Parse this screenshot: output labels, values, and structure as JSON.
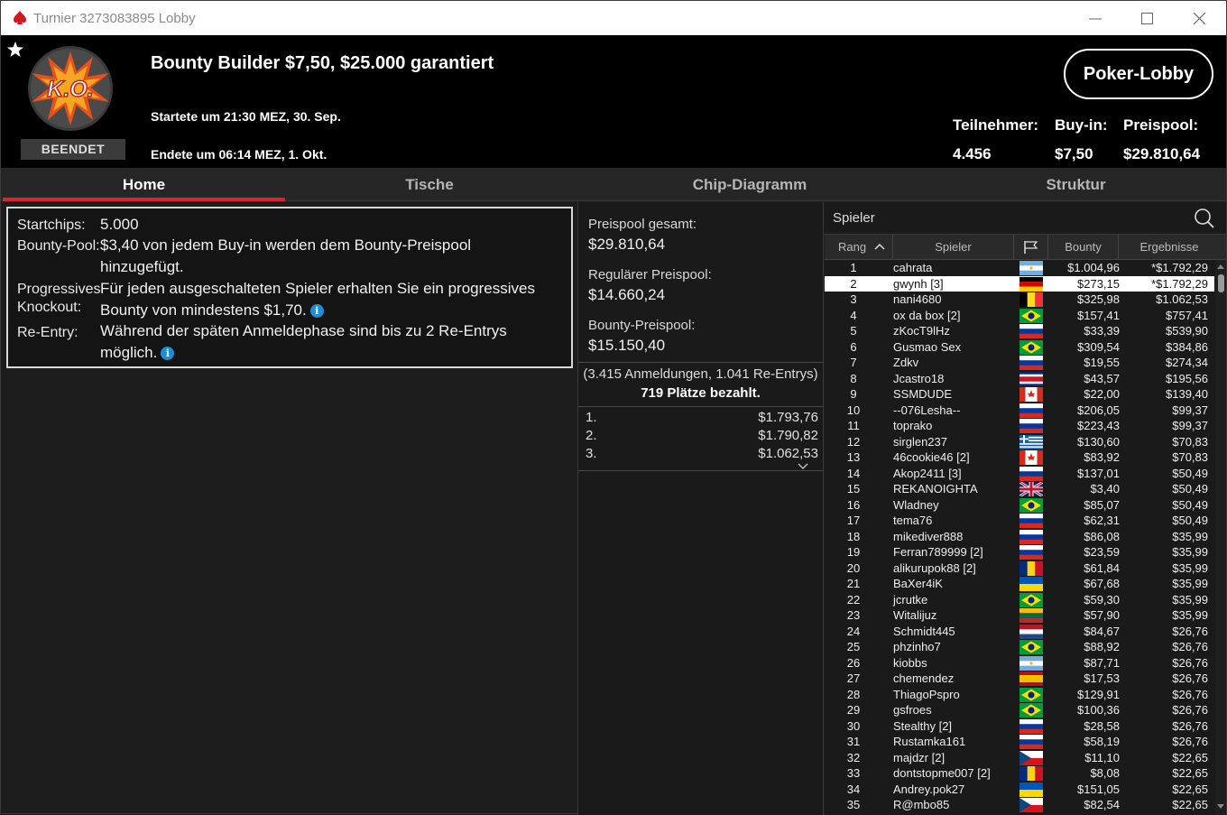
{
  "window": {
    "title": "Turnier 3273083895 Lobby"
  },
  "header": {
    "tournament_title": "Bounty Builder $7,50, $25.000 garantiert",
    "started": "Startete um 21:30 MEZ, 30. Sep.",
    "ended": "Endete um 06:14 MEZ, 1. Okt.",
    "status_badge": "BEENDET",
    "ko_logo_text": "K.O.",
    "lobby_button": "Poker-Lobby",
    "stats": [
      {
        "label": "Teilnehmer:",
        "value": "4.456"
      },
      {
        "label": "Buy-in:",
        "value": "$7,50"
      },
      {
        "label": "Preispool:",
        "value": "$29.810,64"
      }
    ]
  },
  "tabs": [
    {
      "label": "Home",
      "active": true
    },
    {
      "label": "Tische",
      "active": false
    },
    {
      "label": "Chip-Diagramm",
      "active": false
    },
    {
      "label": "Struktur",
      "active": false
    }
  ],
  "info": {
    "startchips_label": "Startchips:",
    "startchips_value": "5.000",
    "bountypool_label": "Bounty-Pool:",
    "bountypool_value": "$3,40 von jedem Buy-in werden dem Bounty-Preispool hinzugefügt.",
    "pko_label_1": "Progressives",
    "pko_label_2": "Knockout:",
    "pko_value": "Für jeden ausgeschalteten Spieler erhalten Sie ein progressives Bounty von mindestens $1,70.",
    "reentry_label": "Re-Entry:",
    "reentry_value": "Während der späten Anmeldephase sind bis zu 2 Re-Entrys möglich."
  },
  "prizepool": {
    "total_label": "Preispool gesamt:",
    "total_value": "$29.810,64",
    "regular_label": "Regulärer Preispool:",
    "regular_value": "$14.660,24",
    "bounty_label": "Bounty-Preispool:",
    "bounty_value": "$15.150,40",
    "registrations": "(3.415 Anmeldungen, 1.041 Re-Entrys)",
    "paid_places": "719 Plätze bezahlt.",
    "payouts": [
      {
        "place": "1.",
        "amount": "$1.793,76"
      },
      {
        "place": "2.",
        "amount": "$1.790,82"
      },
      {
        "place": "3.",
        "amount": "$1.062,53"
      }
    ]
  },
  "players_panel": {
    "search_label": "Spieler",
    "columns": {
      "rank": "Rang",
      "player": "Spieler",
      "bounty": "Bounty",
      "results": "Ergebnisse"
    },
    "highlighted_rank": 2,
    "rows": [
      {
        "rank": "1",
        "name": "cahrata",
        "flag": "ar",
        "bounty": "$1.004,96",
        "result": "*$1.792,29"
      },
      {
        "rank": "2",
        "name": "gwynh [3]",
        "flag": "de",
        "bounty": "$273,15",
        "result": "*$1.792,29"
      },
      {
        "rank": "3",
        "name": "nani4680",
        "flag": "be",
        "bounty": "$325,98",
        "result": "$1.062,53"
      },
      {
        "rank": "4",
        "name": "ox da box [2]",
        "flag": "br",
        "bounty": "$157,41",
        "result": "$757,41"
      },
      {
        "rank": "5",
        "name": "zKocT9lHz",
        "flag": "ru",
        "bounty": "$33,39",
        "result": "$539,90"
      },
      {
        "rank": "6",
        "name": "Gusmao Sex",
        "flag": "br",
        "bounty": "$309,54",
        "result": "$384,86"
      },
      {
        "rank": "7",
        "name": "Zdkv",
        "flag": "ru",
        "bounty": "$19,55",
        "result": "$274,34"
      },
      {
        "rank": "8",
        "name": "Jcastro18",
        "flag": "cr",
        "bounty": "$43,57",
        "result": "$195,56"
      },
      {
        "rank": "9",
        "name": "SSMDUDE",
        "flag": "ca",
        "bounty": "$22,00",
        "result": "$139,40"
      },
      {
        "rank": "10",
        "name": "--076Lesha--",
        "flag": "ru",
        "bounty": "$206,05",
        "result": "$99,37"
      },
      {
        "rank": "11",
        "name": "toprako",
        "flag": "ru",
        "bounty": "$223,43",
        "result": "$99,37"
      },
      {
        "rank": "12",
        "name": "sirglen237",
        "flag": "gr",
        "bounty": "$130,60",
        "result": "$70,83"
      },
      {
        "rank": "13",
        "name": "46cookie46 [2]",
        "flag": "ca",
        "bounty": "$83,92",
        "result": "$70,83"
      },
      {
        "rank": "14",
        "name": "Akop2411 [3]",
        "flag": "ru",
        "bounty": "$137,01",
        "result": "$50,49"
      },
      {
        "rank": "15",
        "name": "REKANOIGHTA",
        "flag": "gb",
        "bounty": "$3,40",
        "result": "$50,49"
      },
      {
        "rank": "16",
        "name": "Wladney",
        "flag": "br",
        "bounty": "$85,07",
        "result": "$50,49"
      },
      {
        "rank": "17",
        "name": "tema76",
        "flag": "ru",
        "bounty": "$62,31",
        "result": "$50,49"
      },
      {
        "rank": "18",
        "name": "mikediver888",
        "flag": "ru",
        "bounty": "$86,08",
        "result": "$35,99"
      },
      {
        "rank": "19",
        "name": "Ferran789999 [2]",
        "flag": "ru",
        "bounty": "$23,59",
        "result": "$35,99"
      },
      {
        "rank": "20",
        "name": "alikurupok88 [2]",
        "flag": "ro",
        "bounty": "$61,84",
        "result": "$35,99"
      },
      {
        "rank": "21",
        "name": "BaXer4iK",
        "flag": "ua",
        "bounty": "$67,68",
        "result": "$35,99"
      },
      {
        "rank": "22",
        "name": "jcrutke",
        "flag": "br",
        "bounty": "$59,30",
        "result": "$35,99"
      },
      {
        "rank": "23",
        "name": "Witalijuz",
        "flag": "lt",
        "bounty": "$57,90",
        "result": "$35,99"
      },
      {
        "rank": "24",
        "name": "Schmidt445",
        "flag": "nl",
        "bounty": "$84,67",
        "result": "$26,76"
      },
      {
        "rank": "25",
        "name": "phzinho7",
        "flag": "br",
        "bounty": "$88,92",
        "result": "$26,76"
      },
      {
        "rank": "26",
        "name": "kiobbs",
        "flag": "ar",
        "bounty": "$87,71",
        "result": "$26,76"
      },
      {
        "rank": "27",
        "name": "chemendez",
        "flag": "es",
        "bounty": "$17,53",
        "result": "$26,76"
      },
      {
        "rank": "28",
        "name": "ThiagoPspro",
        "flag": "br",
        "bounty": "$129,91",
        "result": "$26,76"
      },
      {
        "rank": "29",
        "name": "gsfroes",
        "flag": "br",
        "bounty": "$100,36",
        "result": "$26,76"
      },
      {
        "rank": "30",
        "name": "Stealthy [2]",
        "flag": "ru",
        "bounty": "$28,58",
        "result": "$26,76"
      },
      {
        "rank": "31",
        "name": "Rustamka161",
        "flag": "ru",
        "bounty": "$58,19",
        "result": "$26,76"
      },
      {
        "rank": "32",
        "name": "majdzr [2]",
        "flag": "cz",
        "bounty": "$11,10",
        "result": "$22,65"
      },
      {
        "rank": "33",
        "name": "dontstopme007 [2]",
        "flag": "ro",
        "bounty": "$8,08",
        "result": "$22,65"
      },
      {
        "rank": "34",
        "name": "Andrey.pok27",
        "flag": "ua",
        "bounty": "$151,05",
        "result": "$22,65"
      },
      {
        "rank": "35",
        "name": "R@mbo85",
        "flag": "cz",
        "bounty": "$82,54",
        "result": "$22,65"
      }
    ]
  }
}
